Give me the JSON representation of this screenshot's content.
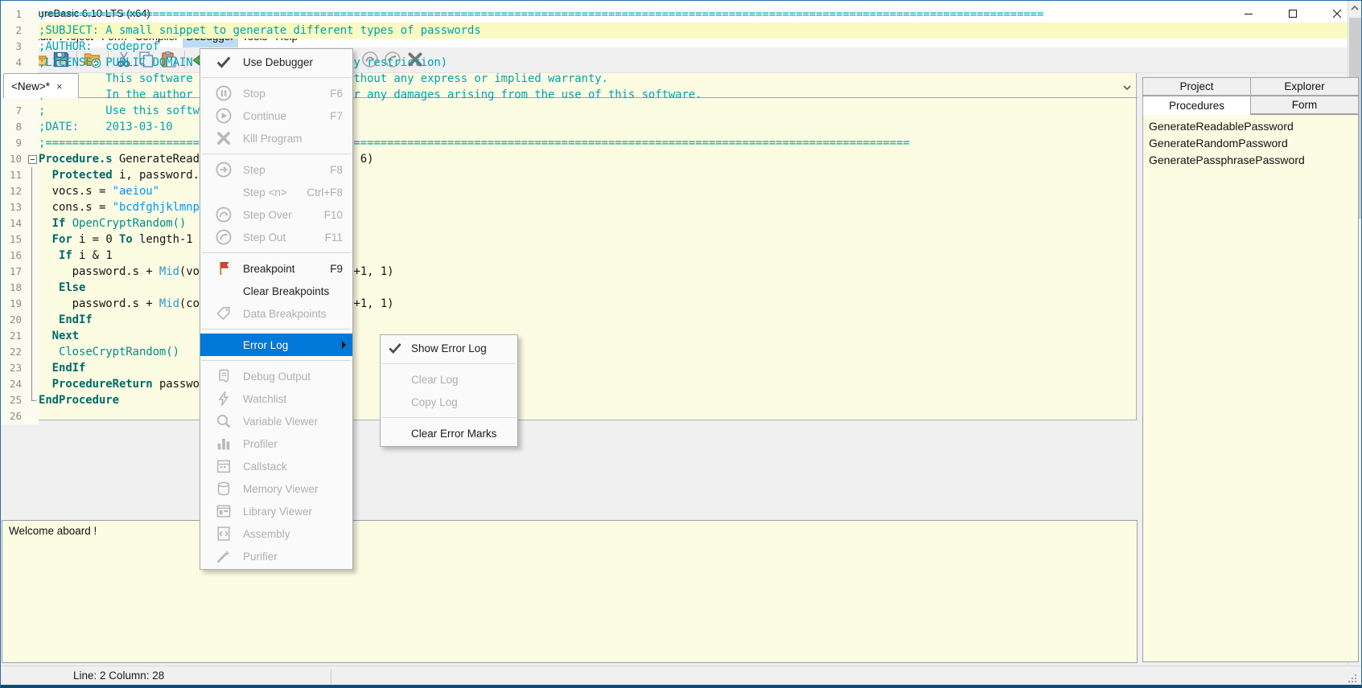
{
  "window": {
    "title": "PureBasic 6.10 LTS (x64)"
  },
  "menubar": {
    "items": [
      {
        "label": "File"
      },
      {
        "label": "Edit"
      },
      {
        "label": "Project"
      },
      {
        "label": "Form"
      },
      {
        "label": "Compiler"
      },
      {
        "label": "Debugger",
        "active": true
      },
      {
        "label": "Tools"
      },
      {
        "label": "Help"
      }
    ]
  },
  "toolbar": {
    "left": [
      {
        "icon": "doc-new",
        "name": "new-source"
      },
      {
        "icon": "folder-open",
        "name": "open-file"
      },
      {
        "icon": "save",
        "name": "save-file"
      },
      {
        "sep": true
      },
      {
        "icon": "folder-sync",
        "name": "open-project"
      },
      {
        "sep": true
      },
      {
        "icon": "cut",
        "name": "cut"
      },
      {
        "icon": "copy",
        "name": "copy"
      },
      {
        "icon": "paste",
        "name": "paste"
      },
      {
        "sep": true
      },
      {
        "icon": "undo",
        "name": "undo"
      }
    ],
    "right": [
      {
        "icon": "stepover-circle24",
        "name": "step-over"
      },
      {
        "icon": "stepout-circle24",
        "name": "step-out"
      },
      {
        "icon": "kill-x-dark",
        "name": "kill-program"
      }
    ]
  },
  "tab": {
    "label": "<New>*",
    "close": "×"
  },
  "editor": {
    "lines": [
      {
        "n": 1,
        "fold": "",
        "t": [
          [
            "c",
            ";====================================================================================================================================================="
          ]
        ]
      },
      {
        "n": 2,
        "hl": true,
        "fold": "",
        "t": [
          [
            "c",
            ";SUBJECT: A small snippet to generate different types of passwords"
          ]
        ]
      },
      {
        "n": 3,
        "fold": "",
        "t": [
          [
            "c",
            ";AUTHOR:  codeprof"
          ]
        ]
      },
      {
        "n": 4,
        "fold": "",
        "t": [
          [
            "c",
            ";LICENSE: PUBLIC DOMAIN (free to use without any restriction)"
          ]
        ]
      },
      {
        "n": 5,
        "fold": "",
        "t": [
          [
            "c",
            ";         This software is provided 'as-is', without any express or implied warranty."
          ]
        ]
      },
      {
        "n": 6,
        "fold": "",
        "t": [
          [
            "c",
            ";         In the author shall be held liable for any damages arising from the use of this software."
          ]
        ]
      },
      {
        "n": 7,
        "fold": "",
        "t": [
          [
            "c",
            ";         Use this software freely"
          ]
        ]
      },
      {
        "n": 8,
        "fold": "",
        "t": [
          [
            "c",
            ";DATE:    2013-03-10"
          ]
        ]
      },
      {
        "n": 9,
        "fold": "",
        "t": [
          [
            "c",
            ";================================================================================================================================="
          ]
        ]
      },
      {
        "n": 10,
        "fold": "box",
        "t": [
          [
            "k",
            "Procedure.s"
          ],
          [
            "n",
            " GenerateReadablePassword(length.i = 6)"
          ]
        ]
      },
      {
        "n": 11,
        "fold": "line",
        "t": [
          [
            "n",
            "  "
          ],
          [
            "k",
            "Protected"
          ],
          [
            "n",
            " i, password.s"
          ]
        ]
      },
      {
        "n": 12,
        "fold": "line",
        "t": [
          [
            "n",
            "  vocs.s = "
          ],
          [
            "s",
            "\"aeiou\""
          ]
        ]
      },
      {
        "n": 13,
        "fold": "line",
        "t": [
          [
            "n",
            "  cons.s = "
          ],
          [
            "s",
            "\"bcdfghjklmnpqrstvwxz\""
          ]
        ]
      },
      {
        "n": 14,
        "fold": "line",
        "t": [
          [
            "n",
            "  "
          ],
          [
            "k",
            "If"
          ],
          [
            "n",
            " "
          ],
          [
            "f",
            "OpenCryptRandom()"
          ]
        ]
      },
      {
        "n": 15,
        "fold": "line",
        "t": [
          [
            "n",
            "  "
          ],
          [
            "k",
            "For"
          ],
          [
            "n",
            " i = 0 "
          ],
          [
            "k",
            "To"
          ],
          [
            "n",
            " length-1"
          ]
        ]
      },
      {
        "n": 16,
        "fold": "line",
        "t": [
          [
            "n",
            "   "
          ],
          [
            "k",
            "If"
          ],
          [
            "n",
            " i & 1"
          ]
        ]
      },
      {
        "n": 17,
        "fold": "line",
        "t": [
          [
            "n",
            "     password.s + "
          ],
          [
            "g",
            "Mid"
          ],
          [
            "n",
            "(vocs, "
          ],
          [
            "g",
            "Random"
          ],
          [
            "n",
            "("
          ],
          [
            "g",
            "Len"
          ],
          [
            "n",
            "(vocs)-2)+1, 1)"
          ]
        ]
      },
      {
        "n": 18,
        "fold": "line",
        "t": [
          [
            "n",
            "   "
          ],
          [
            "k",
            "Else"
          ]
        ]
      },
      {
        "n": 19,
        "fold": "line",
        "t": [
          [
            "n",
            "     password.s + "
          ],
          [
            "g",
            "Mid"
          ],
          [
            "n",
            "(cons, "
          ],
          [
            "g",
            "Random"
          ],
          [
            "n",
            "("
          ],
          [
            "g",
            "Len"
          ],
          [
            "n",
            "(cons)-2)+1, 1)"
          ]
        ]
      },
      {
        "n": 20,
        "fold": "line",
        "t": [
          [
            "n",
            "   "
          ],
          [
            "k",
            "EndIf"
          ]
        ]
      },
      {
        "n": 21,
        "fold": "line",
        "t": [
          [
            "n",
            "  "
          ],
          [
            "k",
            "Next"
          ]
        ]
      },
      {
        "n": 22,
        "fold": "line",
        "t": [
          [
            "n",
            "   "
          ],
          [
            "f",
            "CloseCryptRandom()"
          ]
        ]
      },
      {
        "n": 23,
        "fold": "line",
        "t": [
          [
            "n",
            "  "
          ],
          [
            "k",
            "EndIf"
          ]
        ]
      },
      {
        "n": 24,
        "fold": "line",
        "t": [
          [
            "n",
            "  "
          ],
          [
            "k",
            "ProcedureReturn"
          ],
          [
            "n",
            " password.s"
          ]
        ]
      },
      {
        "n": 25,
        "fold": "end",
        "t": [
          [
            "k",
            "EndProcedure"
          ]
        ]
      },
      {
        "n": 26,
        "fold": "",
        "t": [
          [
            "n",
            ""
          ]
        ]
      }
    ]
  },
  "menu": {
    "items": [
      {
        "label": "Use Debugger",
        "icon": "check",
        "state": "enabled"
      },
      {
        "sep": true
      },
      {
        "label": "Stop",
        "shortcut": "F6",
        "icon": "pause-circle",
        "state": "disabled"
      },
      {
        "label": "Continue",
        "shortcut": "F7",
        "icon": "play-circle",
        "state": "disabled"
      },
      {
        "label": "Kill Program",
        "icon": "kill-x",
        "state": "disabled"
      },
      {
        "sep": true
      },
      {
        "label": "Step",
        "shortcut": "F8",
        "icon": "step-circle",
        "state": "disabled"
      },
      {
        "label": "Step <n>",
        "shortcut": "Ctrl+F8",
        "state": "disabled"
      },
      {
        "label": "Step Over",
        "shortcut": "F10",
        "icon": "stepover-circle",
        "state": "disabled"
      },
      {
        "label": "Step Out",
        "shortcut": "F11",
        "icon": "stepout-circle",
        "state": "disabled"
      },
      {
        "sep": true
      },
      {
        "label": "Breakpoint",
        "shortcut": "F9",
        "icon": "flag",
        "state": "enabled"
      },
      {
        "label": "Clear Breakpoints",
        "state": "enabled"
      },
      {
        "label": "Data Breakpoints",
        "icon": "tag",
        "state": "disabled"
      },
      {
        "sep": true
      },
      {
        "label": "Error Log",
        "state": "highlighted",
        "submenu": true
      },
      {
        "sep": true
      },
      {
        "label": "Debug Output",
        "icon": "scroll",
        "state": "disabled"
      },
      {
        "label": "Watchlist",
        "icon": "bolt",
        "state": "disabled"
      },
      {
        "label": "Variable Viewer",
        "icon": "magnifier",
        "state": "disabled"
      },
      {
        "label": "Profiler",
        "icon": "chart",
        "state": "disabled"
      },
      {
        "label": "Callstack",
        "icon": "calendar",
        "state": "disabled"
      },
      {
        "label": "Memory Viewer",
        "icon": "cylinder",
        "state": "disabled"
      },
      {
        "label": "Library Viewer",
        "icon": "library",
        "state": "disabled"
      },
      {
        "label": "Assembly",
        "icon": "code",
        "state": "disabled"
      },
      {
        "label": "Purifier",
        "icon": "wand",
        "state": "disabled"
      }
    ]
  },
  "submenu": {
    "items": [
      {
        "label": "Show Error Log",
        "icon": "check",
        "state": "enabled"
      },
      {
        "sep": true
      },
      {
        "label": "Clear Log",
        "state": "disabled"
      },
      {
        "label": "Copy Log",
        "state": "disabled"
      },
      {
        "sep": true
      },
      {
        "label": "Clear Error Marks",
        "state": "enabled"
      }
    ]
  },
  "panel": {
    "tabs_row1": [
      {
        "label": "Project"
      },
      {
        "label": "Explorer"
      }
    ],
    "tabs_row2": [
      {
        "label": "Procedures",
        "active": true
      },
      {
        "label": "Form"
      }
    ],
    "procedures": [
      "GenerateReadablePassword",
      "GenerateRandomPassword",
      "GeneratePassphrasePassword"
    ]
  },
  "message": {
    "text": "Welcome aboard !"
  },
  "status": {
    "line_column": "Line: 2   Column: 28"
  },
  "colors": {
    "accent_blue": "#0078D7",
    "menubar_highlight": "#BDDCF3",
    "editor_bg": "#FCFCE3",
    "current_line": "#FAFAC1",
    "comment": "#00A3B0",
    "keyword": "#006A6A",
    "string": "#0094FF",
    "breakpoint_flag": "#E6402E"
  }
}
